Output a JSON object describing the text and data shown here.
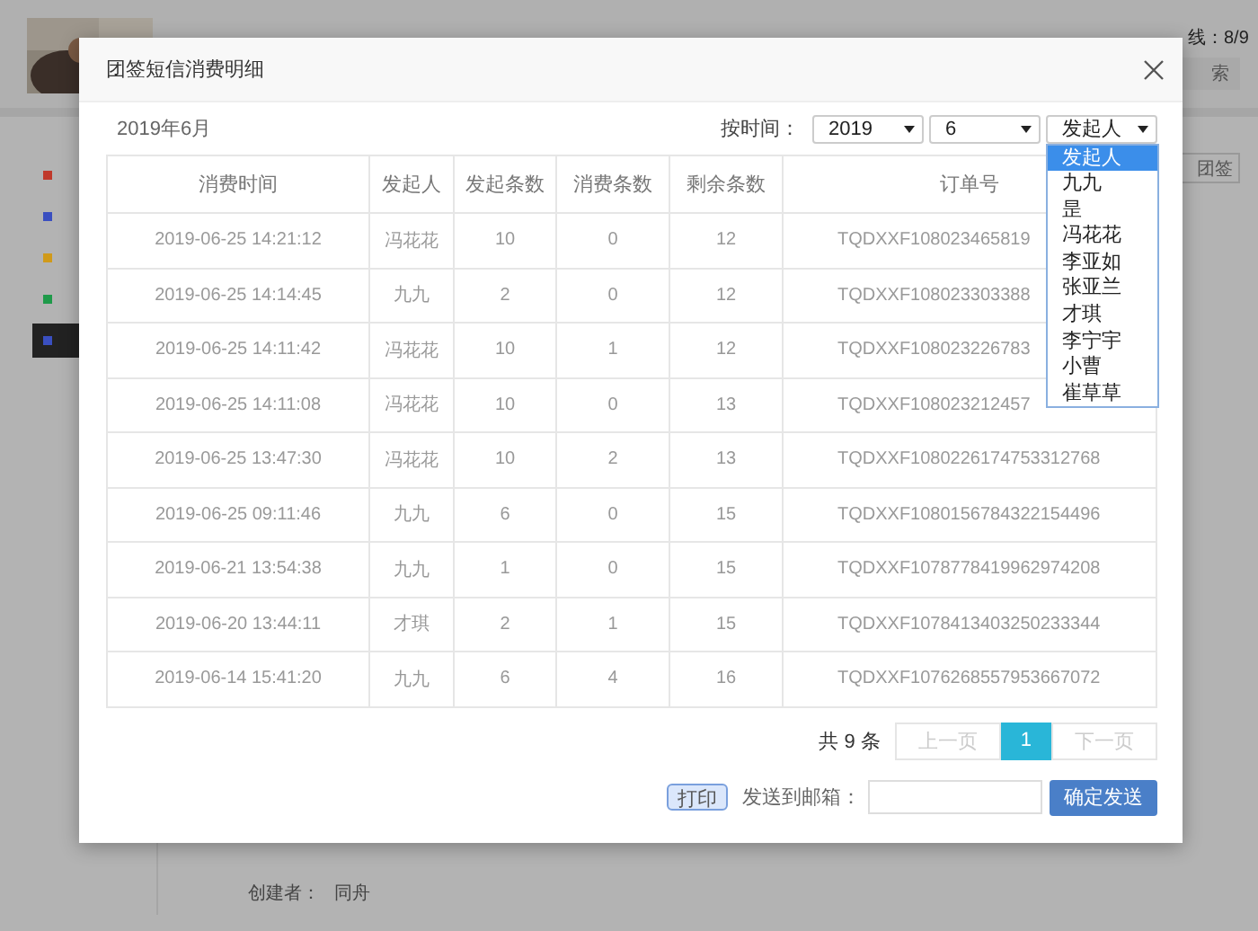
{
  "background": {
    "online": "线：8/9",
    "search_button": "索",
    "sidebar": [
      {
        "color": "#c0392b",
        "selected": false
      },
      {
        "color": "#3a4fc0",
        "selected": false
      },
      {
        "color": "#d09a1a",
        "selected": false
      },
      {
        "color": "#1f9a4a",
        "selected": false
      },
      {
        "color": "#3a4fc0",
        "selected": true
      }
    ],
    "side_button": "团签",
    "creator_label": "创建者：",
    "creator": "同舟"
  },
  "dialog": {
    "title": "团签短信消费明细",
    "period": "2019年6月",
    "filter_label": "按时间：",
    "filters": [
      {
        "value": "2019"
      },
      {
        "value": "6"
      },
      {
        "value": "发起人"
      }
    ],
    "dropdown": {
      "options": [
        {
          "label": "发起人",
          "selected": true
        },
        {
          "label": "九九",
          "selected": false
        },
        {
          "label": "昰",
          "selected": false
        },
        {
          "label": "冯花花",
          "selected": false
        },
        {
          "label": "李亚如",
          "selected": false
        },
        {
          "label": "张亚兰",
          "selected": false
        },
        {
          "label": "才琪",
          "selected": false
        },
        {
          "label": "李宁宇",
          "selected": false
        },
        {
          "label": "小曹",
          "selected": false
        },
        {
          "label": "崔草草",
          "selected": false
        }
      ]
    },
    "table": {
      "columns": [
        "消费时间",
        "发起人",
        "发起条数",
        "消费条数",
        "剩余条数",
        "订单号"
      ],
      "rows": [
        [
          "2019-06-25 14:21:12",
          "冯花花",
          "10",
          "0",
          "12",
          "TQDXXF108023465819"
        ],
        [
          "2019-06-25 14:14:45",
          "九九",
          "2",
          "0",
          "12",
          "TQDXXF108023303388"
        ],
        [
          "2019-06-25 14:11:42",
          "冯花花",
          "10",
          "1",
          "12",
          "TQDXXF108023226783"
        ],
        [
          "2019-06-25 14:11:08",
          "冯花花",
          "10",
          "0",
          "13",
          "TQDXXF108023212457"
        ],
        [
          "2019-06-25 13:47:30",
          "冯花花",
          "10",
          "2",
          "13",
          "TQDXXF1080226174753312768"
        ],
        [
          "2019-06-25 09:11:46",
          "九九",
          "6",
          "0",
          "15",
          "TQDXXF1080156784322154496"
        ],
        [
          "2019-06-21 13:54:38",
          "九九",
          "1",
          "0",
          "15",
          "TQDXXF1078778419962974208"
        ],
        [
          "2019-06-20 13:44:11",
          "才琪",
          "2",
          "1",
          "15",
          "TQDXXF1078413403250233344"
        ],
        [
          "2019-06-14 15:41:20",
          "九九",
          "6",
          "4",
          "16",
          "TQDXXF1076268557953667072"
        ]
      ]
    },
    "pager": {
      "total": "共 9 条",
      "prev": "上一页",
      "pages": [
        {
          "label": "1",
          "selected": true
        }
      ],
      "next": "下一页"
    },
    "print_button": "打印",
    "email_label": "发送到邮箱：",
    "send_button": "确定发送"
  }
}
